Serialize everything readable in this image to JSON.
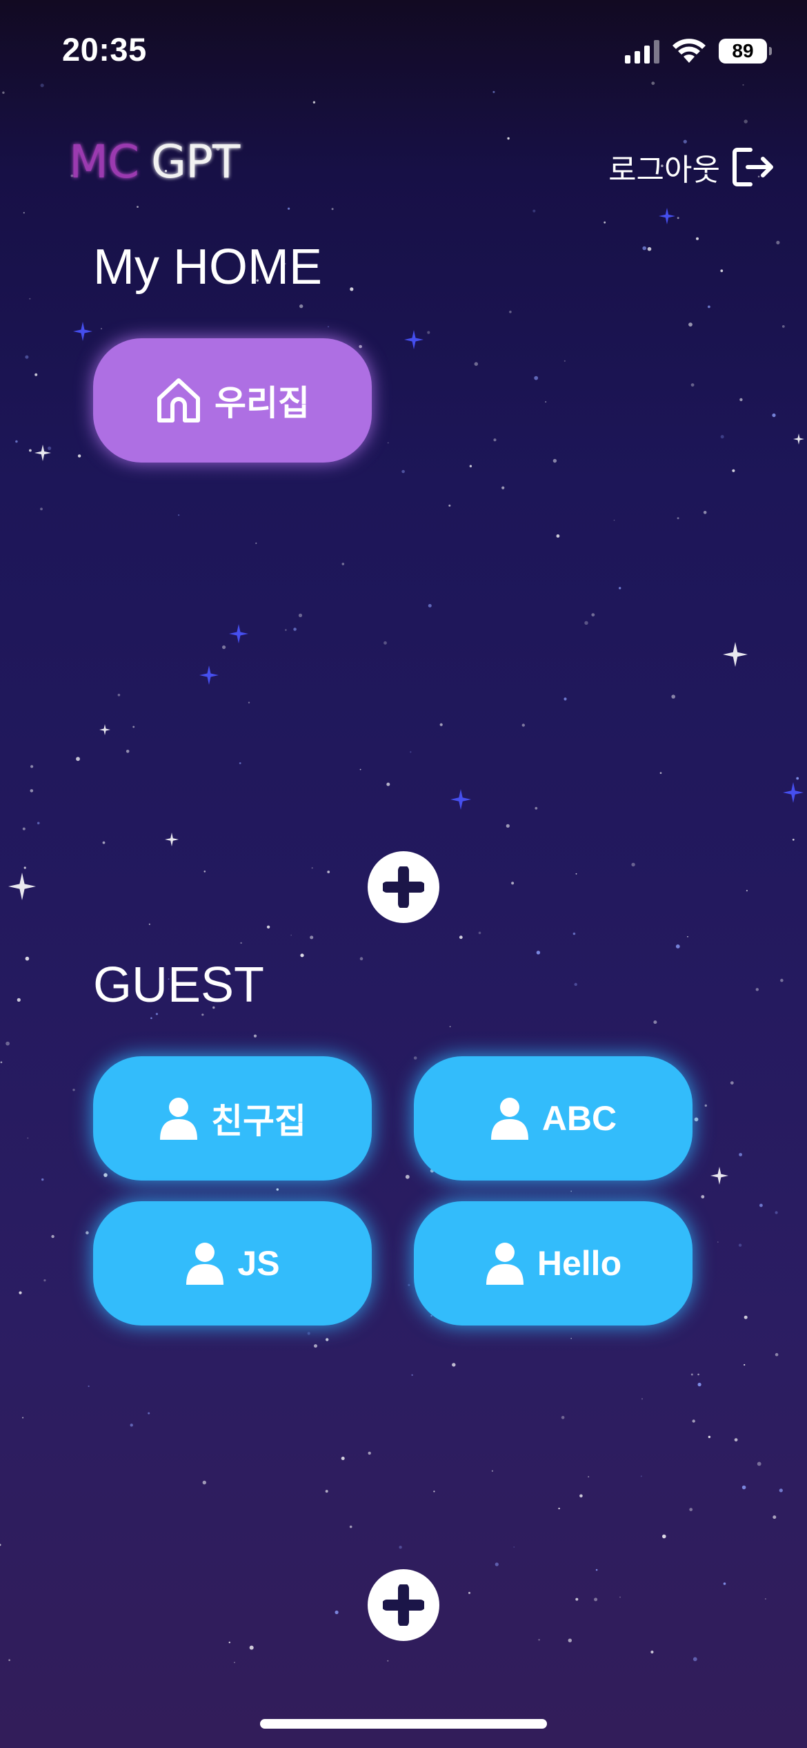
{
  "status_bar": {
    "time": "20:35",
    "battery": "89",
    "icons": [
      "cellular-signal-icon",
      "wifi-icon",
      "battery-icon"
    ]
  },
  "header": {
    "logo_mc": "MC",
    "logo_gpt": "GPT",
    "logout_label": "로그아웃",
    "logout_icon": "logout-arrow-icon"
  },
  "home_section": {
    "title": "My HOME",
    "rooms": [
      {
        "label": "우리집",
        "icon": "house-icon"
      }
    ],
    "add_icon": "plus-icon"
  },
  "guest_section": {
    "title": "GUEST",
    "rooms": [
      {
        "label": "친구집",
        "icon": "person-icon"
      },
      {
        "label": "ABC",
        "icon": "person-icon"
      },
      {
        "label": "JS",
        "icon": "person-icon"
      },
      {
        "label": "Hello",
        "icon": "person-icon"
      }
    ],
    "add_icon": "plus-icon"
  },
  "colors": {
    "home_button": "#ae6fe3",
    "guest_button": "#33bcfb",
    "logo_mc": "#9b3ab0",
    "background_top": "#120a22",
    "background_bottom": "#321d5a"
  }
}
